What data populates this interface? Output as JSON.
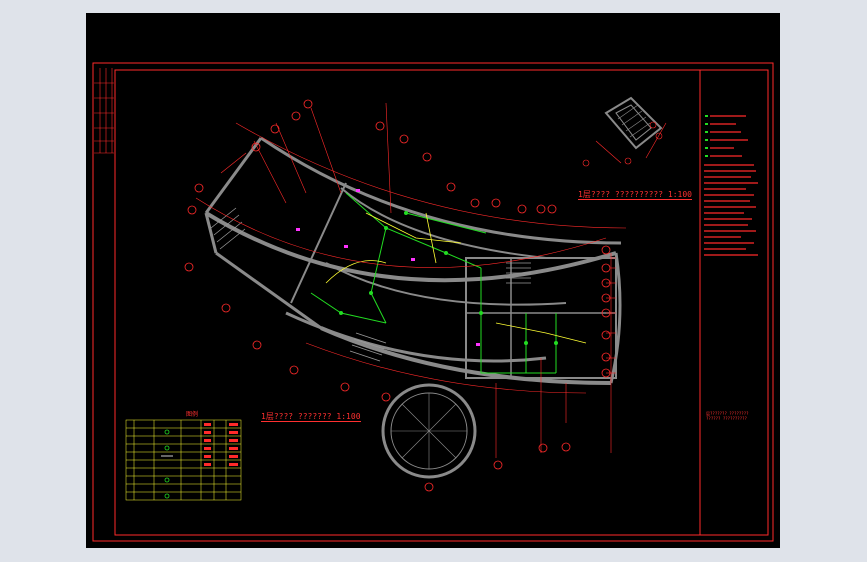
{
  "plan_title": "1层???? ??????? 1:100",
  "stair_title": "1层???? ?????????? 1:100",
  "right_note": "层??????? ????????\n?????? ??????????",
  "legend_title": "图例",
  "colors": {
    "background": "#000000",
    "frame": "#ff2a2a",
    "wall": "#8a8a8a",
    "accent_green": "#22dd22",
    "accent_yellow": "#ffff33",
    "accent_magenta": "#ff33ff"
  },
  "icons": {
    "legend_symbols": [
      "circle-symbol",
      "light-symbol",
      "switch-symbol"
    ]
  }
}
